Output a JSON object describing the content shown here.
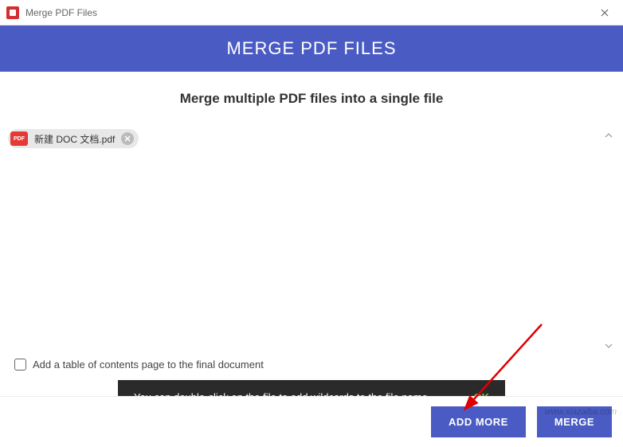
{
  "window": {
    "title": "Merge PDF Files"
  },
  "header": {
    "title": "MERGE PDF FILES"
  },
  "subtitle": "Merge multiple PDF files into a single file",
  "files": [
    {
      "badge": "PDF",
      "name": "新建 DOC 文档.pdf"
    }
  ],
  "checkbox": {
    "label": "Add a table of contents page to the final document"
  },
  "toast": {
    "message": "You can double-click on the file to add wildcards to the file name",
    "ok": "OK"
  },
  "buttons": {
    "add_more": "ADD MORE",
    "merge": "MERGE"
  },
  "watermark": "www.xiazaiba.com"
}
